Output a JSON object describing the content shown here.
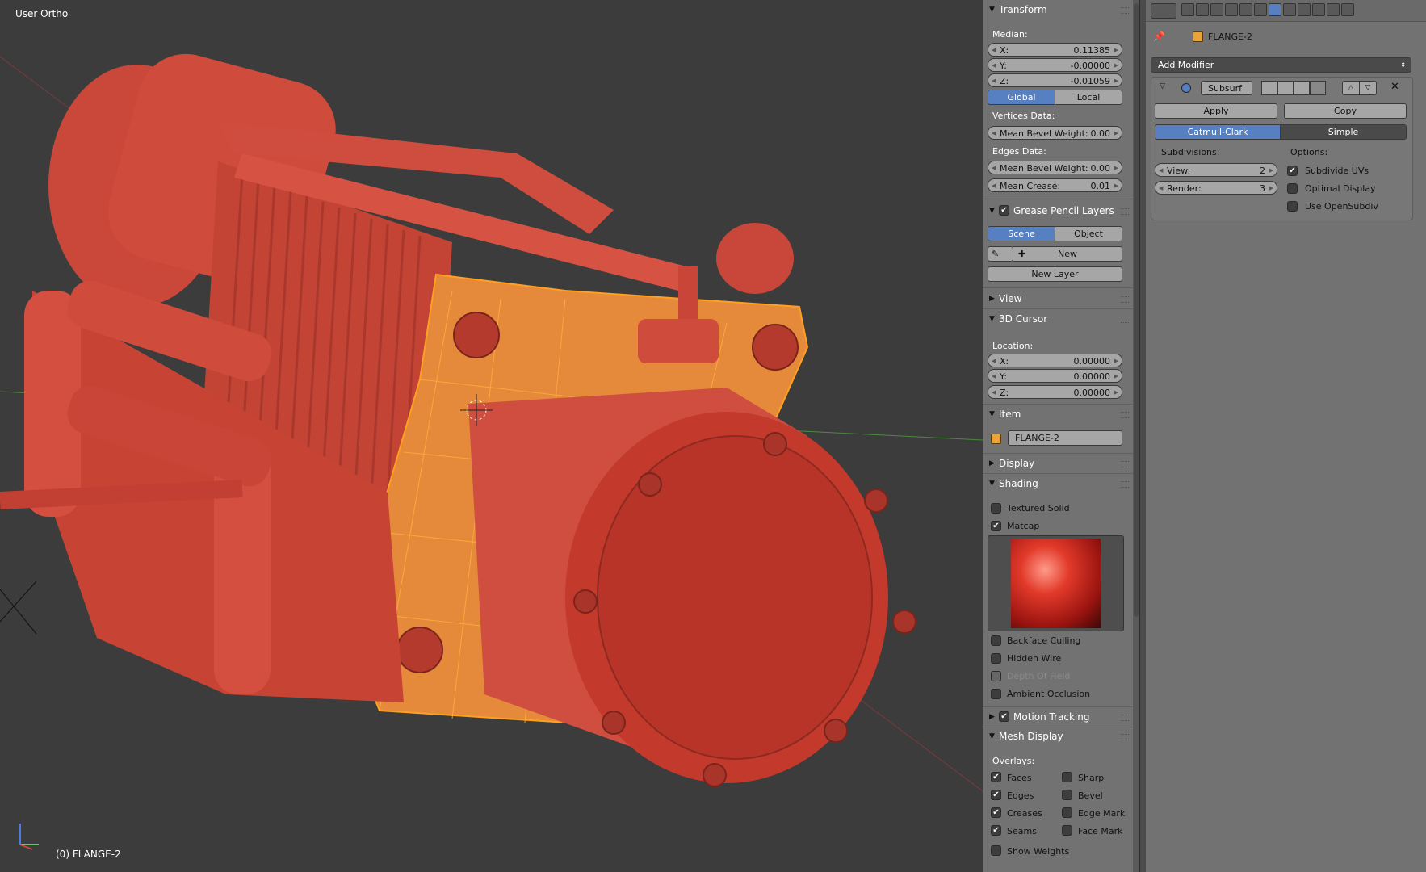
{
  "viewport": {
    "view_label": "User Ortho",
    "object_label": "(0) FLANGE-2"
  },
  "transform": {
    "header": "Transform",
    "median_label": "Median:",
    "x_label": "X:",
    "x_value": "0.11385",
    "y_label": "Y:",
    "y_value": "-0.00000",
    "z_label": "Z:",
    "z_value": "-0.01059",
    "global_label": "Global",
    "local_label": "Local",
    "vertices_data_label": "Vertices Data:",
    "vertex_bevel_label": "Mean Bevel Weight:",
    "vertex_bevel_value": "0.00",
    "edges_data_label": "Edges Data:",
    "edge_bevel_label": "Mean Bevel Weight:",
    "edge_bevel_value": "0.00",
    "crease_label": "Mean Crease:",
    "crease_value": "0.01"
  },
  "grease_pencil": {
    "header": "Grease Pencil Layers",
    "scene_label": "Scene",
    "object_label": "Object",
    "new_label": "New",
    "new_layer_label": "New Layer"
  },
  "view_panel": {
    "header": "View"
  },
  "cursor": {
    "header": "3D Cursor",
    "location_label": "Location:",
    "x_label": "X:",
    "x_value": "0.00000",
    "y_label": "Y:",
    "y_value": "0.00000",
    "z_label": "Z:",
    "z_value": "0.00000"
  },
  "item": {
    "header": "Item",
    "name": "FLANGE-2"
  },
  "display_panel": {
    "header": "Display"
  },
  "shading": {
    "header": "Shading",
    "textured_solid": "Textured Solid",
    "matcap": "Matcap",
    "backface_culling": "Backface Culling",
    "hidden_wire": "Hidden Wire",
    "depth_of_field": "Depth Of Field",
    "ambient_occlusion": "Ambient Occlusion"
  },
  "motion_tracking": {
    "header": "Motion Tracking"
  },
  "mesh_display": {
    "header": "Mesh Display",
    "overlays_label": "Overlays:",
    "faces": "Faces",
    "sharp": "Sharp",
    "edges": "Edges",
    "bevel": "Bevel",
    "creases": "Creases",
    "edge_mark": "Edge Mark",
    "seams": "Seams",
    "face_mark": "Face Mark",
    "show_weights": "Show Weights"
  },
  "modifiers": {
    "object_name": "FLANGE-2",
    "add_modifier": "Add Modifier",
    "modifier_name": "Subsurf",
    "apply_label": "Apply",
    "copy_label": "Copy",
    "catmull_label": "Catmull-Clark",
    "simple_label": "Simple",
    "subdivisions_label": "Subdivisions:",
    "options_label": "Options:",
    "view_label": "View:",
    "view_value": "2",
    "render_label": "Render:",
    "render_value": "3",
    "subdivide_uvs": "Subdivide UVs",
    "optimal_display": "Optimal Display",
    "use_opensubdiv": "Use OpenSubdiv"
  }
}
